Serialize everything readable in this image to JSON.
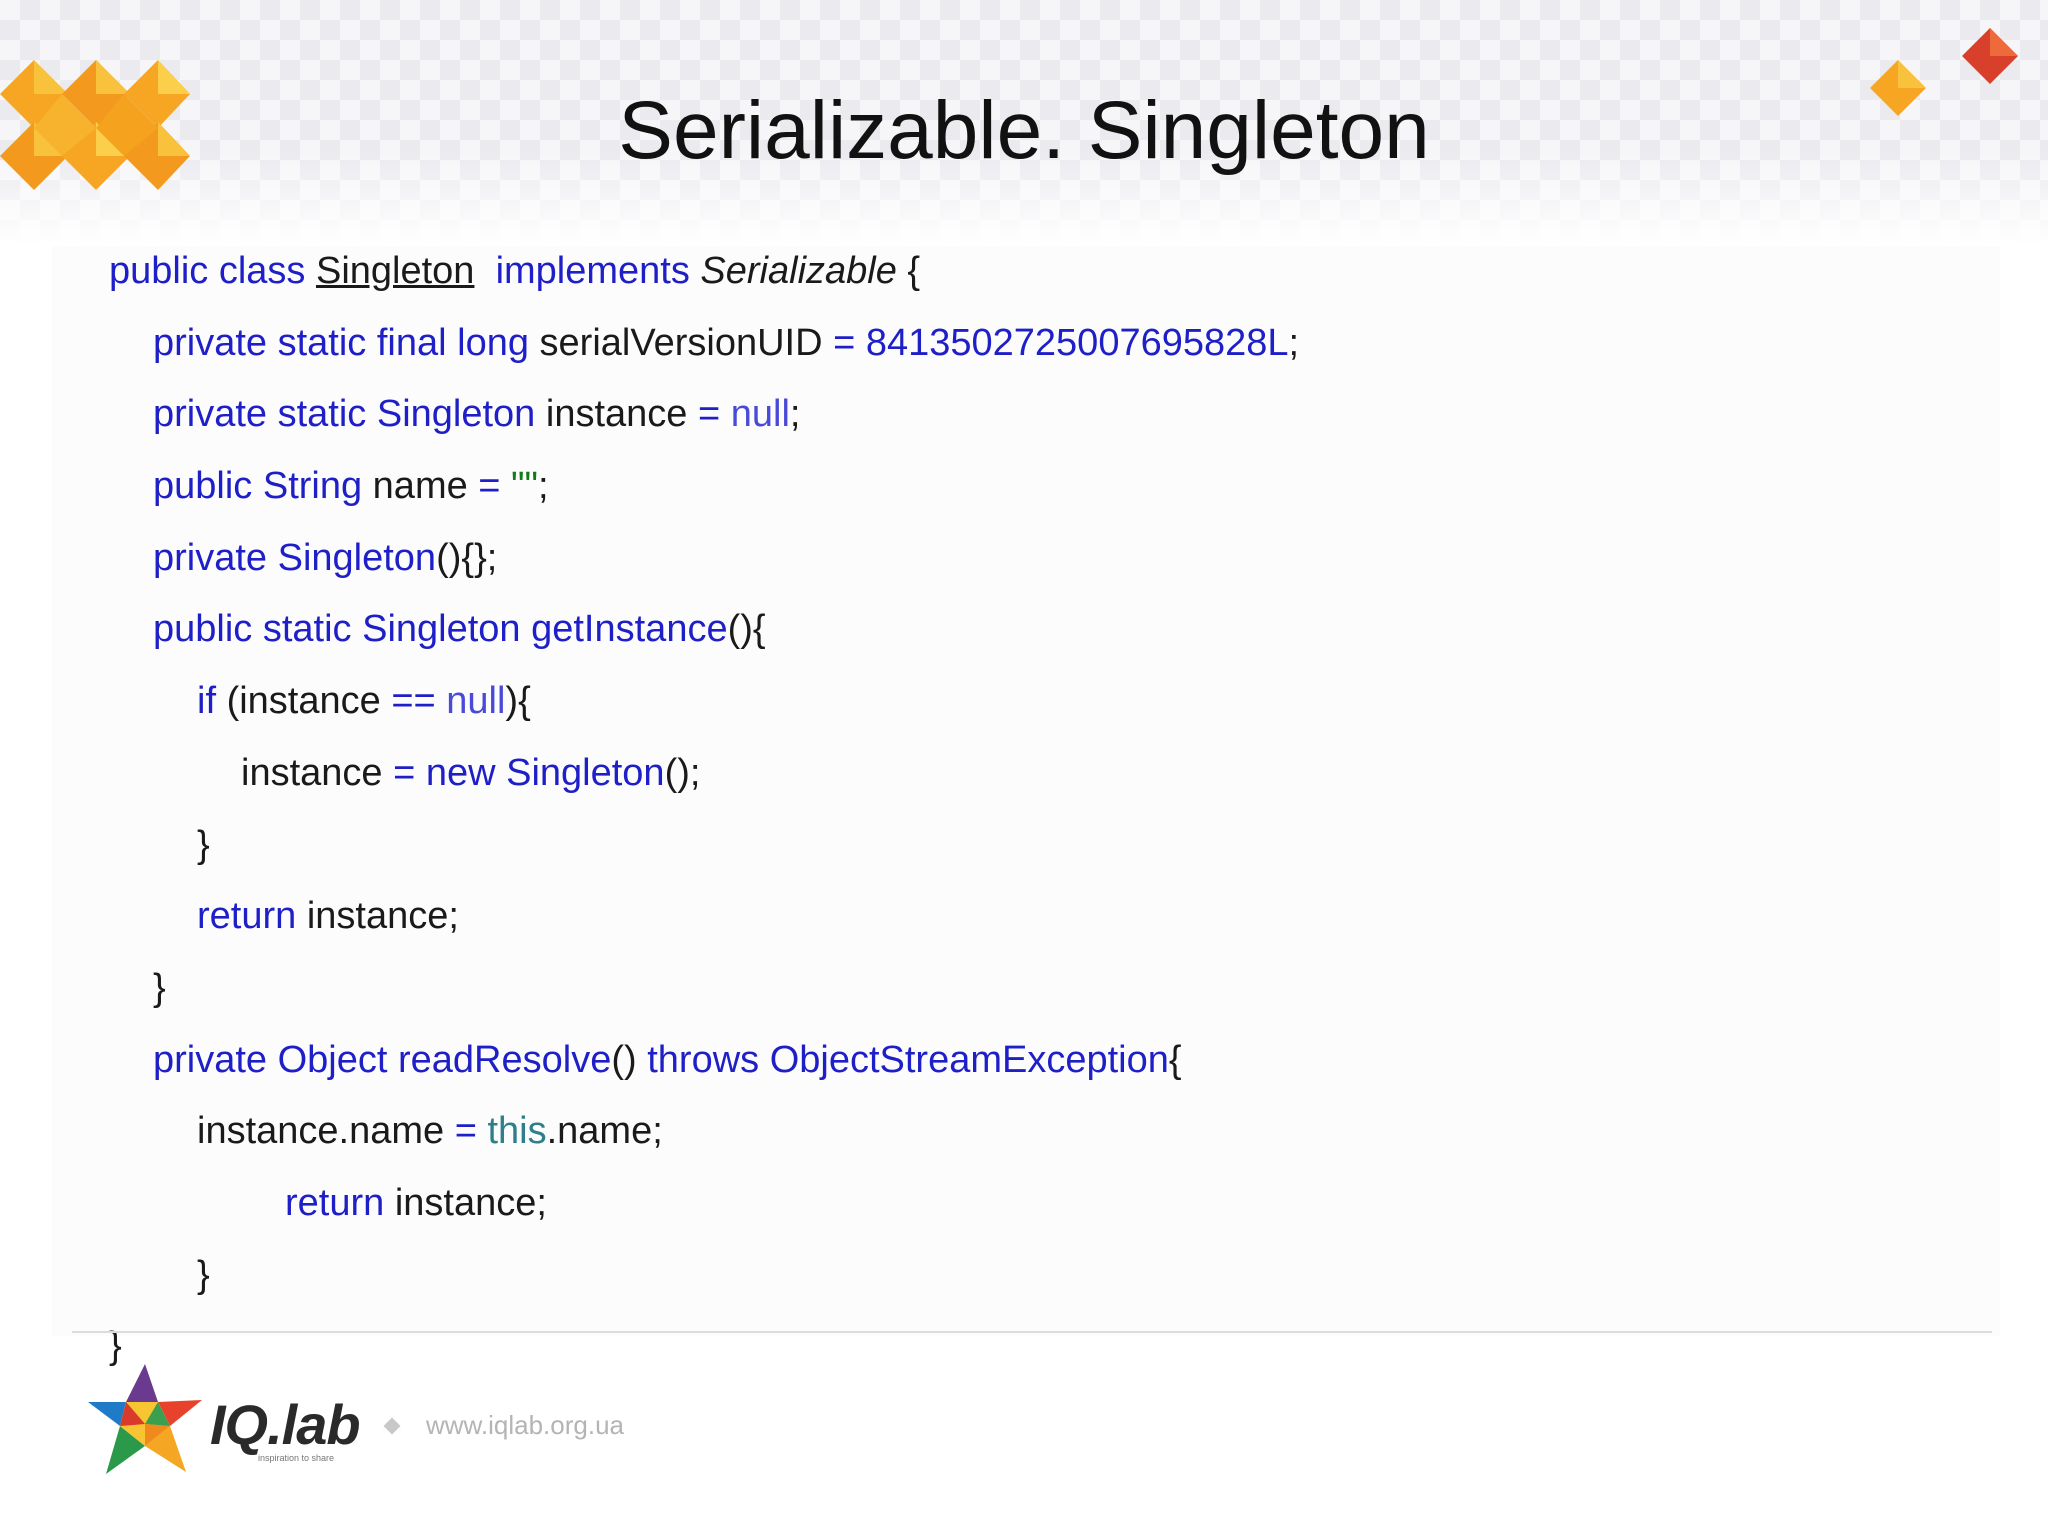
{
  "slide": {
    "title": "Serializable. Singleton",
    "colors": {
      "keyword": "#1f1fc8",
      "literal": "#4a4ad8",
      "string": "#157a1c",
      "this": "#2e7f8a",
      "plain": "#1a1a1a",
      "logo_orange": "#f5a623",
      "logo_red": "#d9402b"
    }
  },
  "code": {
    "l1": {
      "a": "public class ",
      "b": "Singleton",
      "c": "  implements ",
      "d": "Serializable",
      "e": " {"
    },
    "l2": {
      "a": "private static final long ",
      "b": "serialVersionUID ",
      "c": "= 8413502725007695828L",
      "d": ";"
    },
    "l3": {
      "a": "private static Singleton ",
      "b": "instance ",
      "c": "= ",
      "d": "null",
      "e": ";"
    },
    "l4": {
      "a": "public String ",
      "b": "name ",
      "c": "= ",
      "d": "\"\"",
      "e": ";"
    },
    "l5": {
      "a": "private Singleton",
      "b": "(){};"
    },
    "l6": {
      "a": "public static Singleton getInstance",
      "b": "(){"
    },
    "l7": {
      "a": "if ",
      "b": "(instance ",
      "c": "== ",
      "d": "null",
      "e": "){"
    },
    "l8": {
      "a": "instance ",
      "b": "= new Singleton",
      "c": "();"
    },
    "l9": {
      "a": "}"
    },
    "l10": {
      "a": "return ",
      "b": "instance;"
    },
    "l11": {
      "a": "}"
    },
    "l12": {
      "a": "private Object readResolve",
      "b": "() ",
      "c": "throws ObjectStreamException",
      "d": "{"
    },
    "l13": {
      "a": "instance.name ",
      "b": "= ",
      "c": "this",
      "d": ".name;"
    },
    "l14": {
      "a": "return ",
      "b": "instance;"
    },
    "l15": {
      "a": "}"
    },
    "l16": {
      "a": "}"
    }
  },
  "footer": {
    "brand": "IQ.lab",
    "tagline": "inspiration to share",
    "url": "www.iqlab.org.ua",
    "logo_icon": "star-logo-icon"
  }
}
